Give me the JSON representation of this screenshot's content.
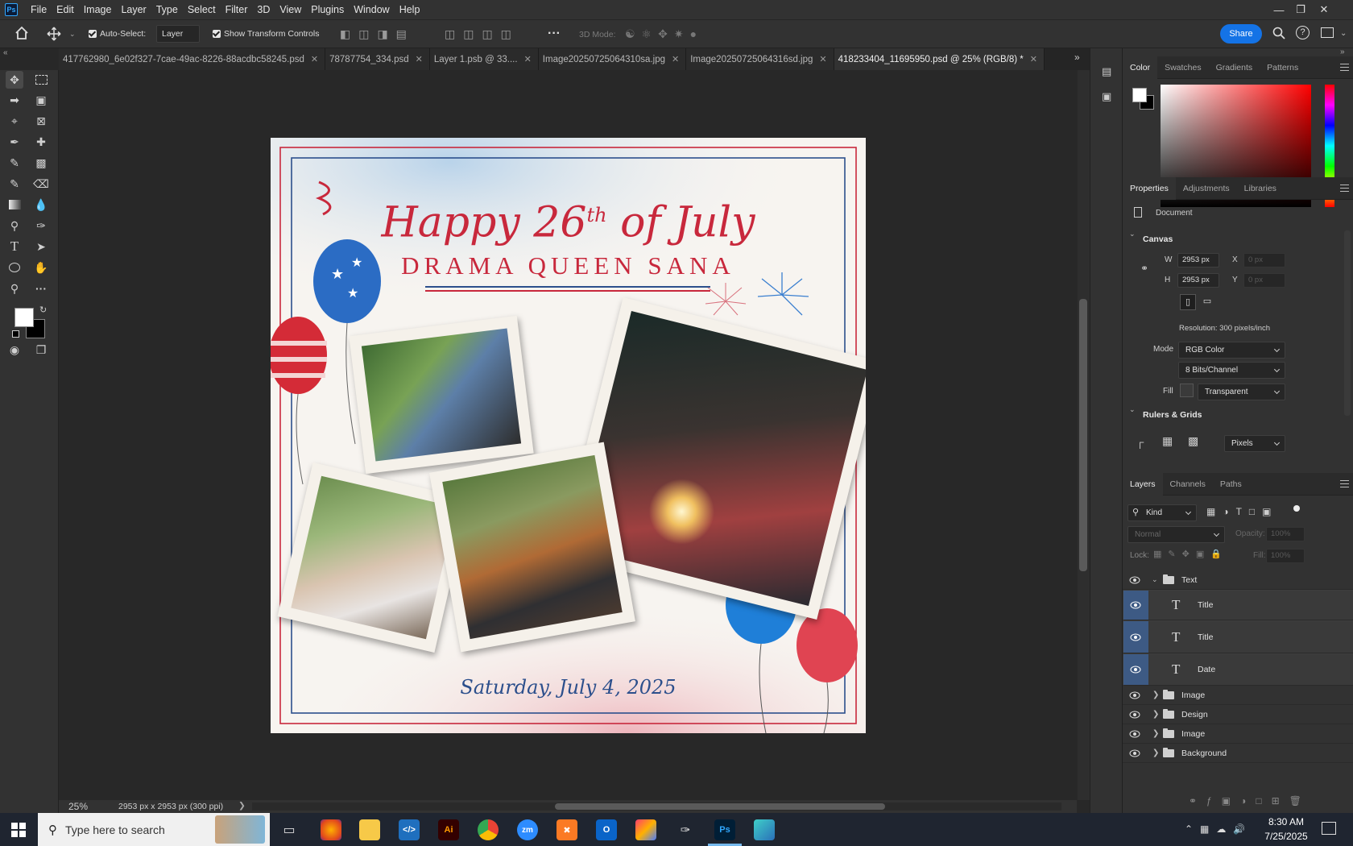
{
  "menu": [
    "File",
    "Edit",
    "Image",
    "Layer",
    "Type",
    "Select",
    "Filter",
    "3D",
    "View",
    "Plugins",
    "Window",
    "Help"
  ],
  "app_logo": "Ps",
  "options": {
    "auto_select_label": "Auto-Select:",
    "auto_select_value": "Layer",
    "show_transform_label": "Show Transform Controls",
    "mode_3d_label": "3D Mode:",
    "share_label": "Share"
  },
  "tabs": [
    {
      "label": "417762980_6e02f327-7cae-49ac-8226-88acdbc58245.psd",
      "active": false
    },
    {
      "label": "78787754_334.psd",
      "active": false
    },
    {
      "label": "Layer 1.psb @ 33....",
      "active": false
    },
    {
      "label": "Image20250725064310sa.jpg",
      "active": false
    },
    {
      "label": "Image20250725064316sd.jpg",
      "active": false
    },
    {
      "label": "418233404_11695950.psd @ 25% (RGB/8) *",
      "active": true
    }
  ],
  "poster": {
    "title": "Happy 26",
    "title_sup": "th",
    "title_end": "of July",
    "subtitle": "DRAMA QUEEN SANA",
    "date": "Saturday, July 4, 2025",
    "colors": {
      "red": "#c8283c",
      "blue": "#2c4f8c",
      "paper": "#f7f4f0"
    }
  },
  "status": {
    "zoom": "25%",
    "doc_info": "2953 px x 2953 px (300 ppi)"
  },
  "color_panel": {
    "tabs": [
      "Color",
      "Swatches",
      "Gradients",
      "Patterns"
    ]
  },
  "properties": {
    "tabs": [
      "Properties",
      "Adjustments",
      "Libraries"
    ],
    "doc_label": "Document",
    "canvas_label": "Canvas",
    "w_label": "W",
    "w_value": "2953 px",
    "h_label": "H",
    "h_value": "2953 px",
    "x_label": "X",
    "x_value": "0 px",
    "y_label": "Y",
    "y_value": "0 px",
    "resolution": "Resolution: 300 pixels/inch",
    "mode_label": "Mode",
    "mode_value": "RGB Color",
    "bits_value": "8 Bits/Channel",
    "fill_label": "Fill",
    "fill_value": "Transparent",
    "rulers_label": "Rulers & Grids",
    "units_value": "Pixels"
  },
  "layers_panel": {
    "tabs": [
      "Layers",
      "Channels",
      "Paths"
    ],
    "kind_label": "Kind",
    "blend_value": "Normal",
    "opacity_label": "Opacity:",
    "opacity_value": "100%",
    "lock_label": "Lock:",
    "fill_label": "Fill:",
    "fill_value": "100%",
    "layers": [
      {
        "name": "Text",
        "type": "group",
        "open": true
      },
      {
        "name": "Title",
        "type": "text"
      },
      {
        "name": "Title",
        "type": "text"
      },
      {
        "name": "Date",
        "type": "text"
      },
      {
        "name": "Image",
        "type": "group"
      },
      {
        "name": "Design",
        "type": "group"
      },
      {
        "name": "Image",
        "type": "group"
      },
      {
        "name": "Background",
        "type": "group"
      }
    ]
  },
  "taskbar": {
    "search_placeholder": "Type here to search",
    "time": "8:30 AM",
    "date": "7/25/2025"
  }
}
